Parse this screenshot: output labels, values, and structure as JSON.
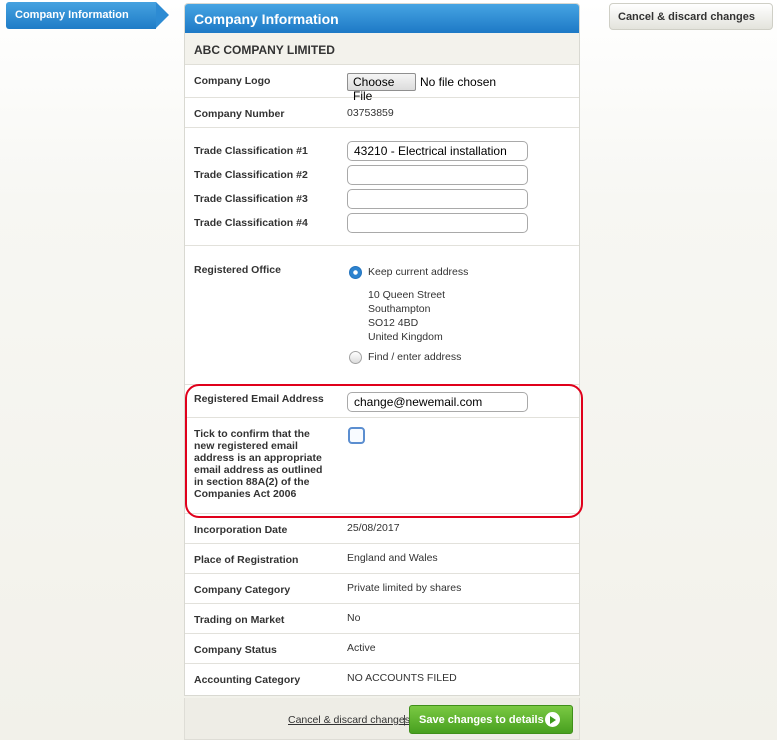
{
  "nav": {
    "active_tab": "Company Information"
  },
  "top": {
    "cancel_label": "Cancel & discard changes"
  },
  "panel": {
    "title": "Company Information",
    "company_name": "ABC COMPANY LIMITED"
  },
  "logo": {
    "label": "Company Logo",
    "button": "Choose File",
    "status": "No file chosen"
  },
  "number": {
    "label": "Company Number",
    "value": "03753859"
  },
  "trade": {
    "label1": "Trade Classification #1",
    "label2": "Trade Classification #2",
    "label3": "Trade Classification #3",
    "label4": "Trade Classification #4",
    "value1": "43210 - Electrical installation",
    "value2": "",
    "value3": "",
    "value4": ""
  },
  "office": {
    "label": "Registered Office",
    "keep_label": "Keep current address",
    "address": [
      "10 Queen Street",
      "Southampton",
      "SO12 4BD",
      "United Kingdom"
    ],
    "find_label": "Find / enter address"
  },
  "email": {
    "label": "Registered Email Address",
    "value": "change@newemail.com",
    "confirm_lines": [
      "Tick to confirm that the",
      "new registered email",
      "address is an appropriate",
      "email address as outlined",
      "in section 88A(2) of the",
      "Companies Act 2006"
    ]
  },
  "details": [
    {
      "label": "Incorporation Date",
      "value": "25/08/2017"
    },
    {
      "label": "Place of Registration",
      "value": "England and Wales"
    },
    {
      "label": "Company Category",
      "value": "Private limited by shares"
    },
    {
      "label": "Trading on Market",
      "value": "No"
    },
    {
      "label": "Company Status",
      "value": "Active"
    },
    {
      "label": "Accounting Category",
      "value": "NO ACCOUNTS FILED"
    }
  ],
  "footer": {
    "cancel_label": "Cancel & discard changes",
    "separator": "|",
    "save_label": "Save changes to details"
  },
  "colors": {
    "header_blue": "#1d79c6",
    "save_green": "#47a01f",
    "highlight_red": "#e0001b"
  }
}
